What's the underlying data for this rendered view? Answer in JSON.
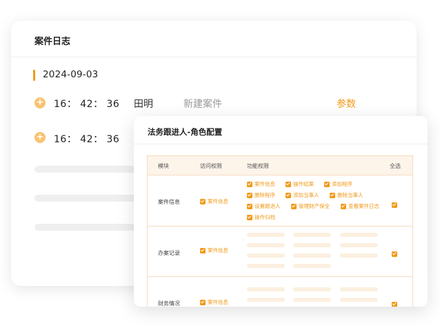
{
  "case_log": {
    "title": "案件日志",
    "date": "2024-09-03",
    "entries": [
      {
        "time": "16： 42： 36",
        "user": "田明",
        "action": "新建案件",
        "link": "参数"
      },
      {
        "time": "16： 42： 36"
      }
    ]
  },
  "role_config": {
    "title": "法务跟进人-角色配置",
    "columns": [
      "模块",
      "访问权限",
      "功能权限",
      "全选"
    ],
    "rows": [
      {
        "module": "案件信息",
        "access": "案件信息",
        "functions": [
          "案件信息",
          "操作结案",
          "添加程序",
          "删除程序",
          "添加当事人",
          "删除当事人",
          "设置跟进人",
          "管理财产保全",
          "查看案件日志",
          "操作归档"
        ]
      },
      {
        "module": "办案记录",
        "access": "案件信息"
      },
      {
        "module": "财务情况",
        "access": "案件信息"
      }
    ]
  },
  "colors": {
    "accent": "#f29a1a",
    "dot": "#f8c36f",
    "table_border": "#f6dcc0",
    "table_head": "#fdf4ea"
  }
}
